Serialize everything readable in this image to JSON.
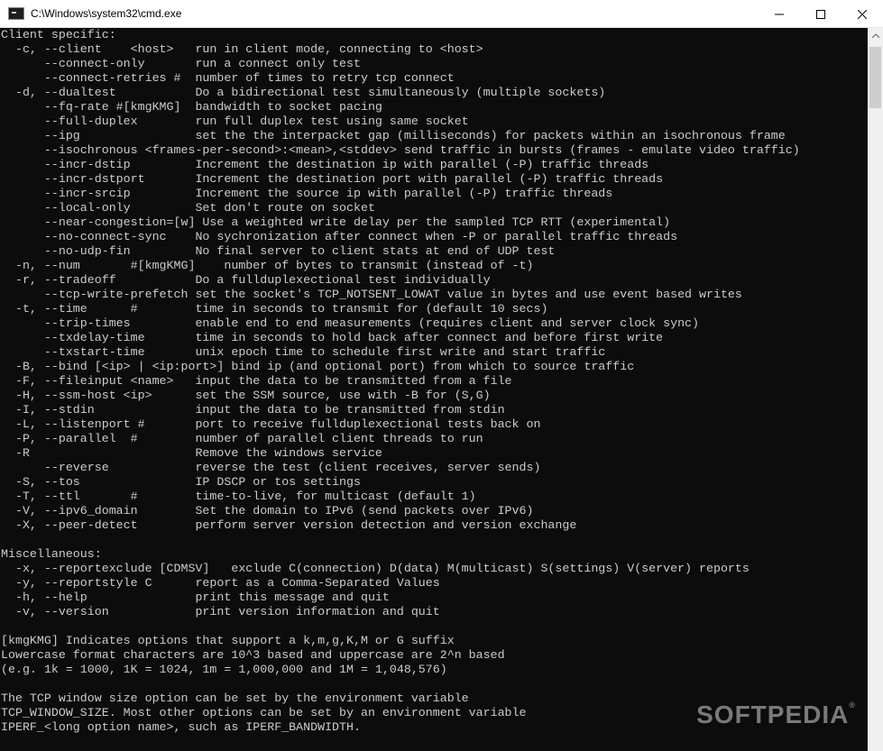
{
  "window": {
    "title": "C:\\Windows\\system32\\cmd.exe",
    "minimize_icon": "minimize-icon",
    "maximize_icon": "maximize-icon",
    "close_icon": "close-icon"
  },
  "colors": {
    "console_background": "#0c0c0c",
    "console_text": "#cccccc",
    "titlebar": "#ffffff",
    "scrollbar_track": "#f0f0f0",
    "scrollbar_thumb": "#cdcdcd"
  },
  "console": {
    "lines": [
      "Client specific:",
      "  -c, --client    <host>   run in client mode, connecting to <host>",
      "      --connect-only       run a connect only test",
      "      --connect-retries #  number of times to retry tcp connect",
      "  -d, --dualtest           Do a bidirectional test simultaneously (multiple sockets)",
      "      --fq-rate #[kmgKMG]  bandwidth to socket pacing",
      "      --full-duplex        run full duplex test using same socket",
      "      --ipg                set the the interpacket gap (milliseconds) for packets within an isochronous frame",
      "      --isochronous <frames-per-second>:<mean>,<stddev> send traffic in bursts (frames - emulate video traffic)",
      "      --incr-dstip         Increment the destination ip with parallel (-P) traffic threads",
      "      --incr-dstport       Increment the destination port with parallel (-P) traffic threads",
      "      --incr-srcip         Increment the source ip with parallel (-P) traffic threads",
      "      --local-only         Set don't route on socket",
      "      --near-congestion=[w] Use a weighted write delay per the sampled TCP RTT (experimental)",
      "      --no-connect-sync    No sychronization after connect when -P or parallel traffic threads",
      "      --no-udp-fin         No final server to client stats at end of UDP test",
      "  -n, --num       #[kmgKMG]    number of bytes to transmit (instead of -t)",
      "  -r, --tradeoff           Do a fullduplexectional test individually",
      "      --tcp-write-prefetch set the socket's TCP_NOTSENT_LOWAT value in bytes and use event based writes",
      "  -t, --time      #        time in seconds to transmit for (default 10 secs)",
      "      --trip-times         enable end to end measurements (requires client and server clock sync)",
      "      --txdelay-time       time in seconds to hold back after connect and before first write",
      "      --txstart-time       unix epoch time to schedule first write and start traffic",
      "  -B, --bind [<ip> | <ip:port>] bind ip (and optional port) from which to source traffic",
      "  -F, --fileinput <name>   input the data to be transmitted from a file",
      "  -H, --ssm-host <ip>      set the SSM source, use with -B for (S,G)",
      "  -I, --stdin              input the data to be transmitted from stdin",
      "  -L, --listenport #       port to receive fullduplexectional tests back on",
      "  -P, --parallel  #        number of parallel client threads to run",
      "  -R                       Remove the windows service",
      "      --reverse            reverse the test (client receives, server sends)",
      "  -S, --tos                IP DSCP or tos settings",
      "  -T, --ttl       #        time-to-live, for multicast (default 1)",
      "  -V, --ipv6_domain        Set the domain to IPv6 (send packets over IPv6)",
      "  -X, --peer-detect        perform server version detection and version exchange",
      "",
      "Miscellaneous:",
      "  -x, --reportexclude [CDMSV]   exclude C(connection) D(data) M(multicast) S(settings) V(server) reports",
      "  -y, --reportstyle C      report as a Comma-Separated Values",
      "  -h, --help               print this message and quit",
      "  -v, --version            print version information and quit",
      "",
      "[kmgKMG] Indicates options that support a k,m,g,K,M or G suffix",
      "Lowercase format characters are 10^3 based and uppercase are 2^n based",
      "(e.g. 1k = 1000, 1K = 1024, 1m = 1,000,000 and 1M = 1,048,576)",
      "",
      "The TCP window size option can be set by the environment variable",
      "TCP_WINDOW_SIZE. Most other options can be set by an environment variable",
      "IPERF_<long option name>, such as IPERF_BANDWIDTH."
    ]
  },
  "watermark": {
    "text": "SOFTPEDIA",
    "mark": "®"
  }
}
